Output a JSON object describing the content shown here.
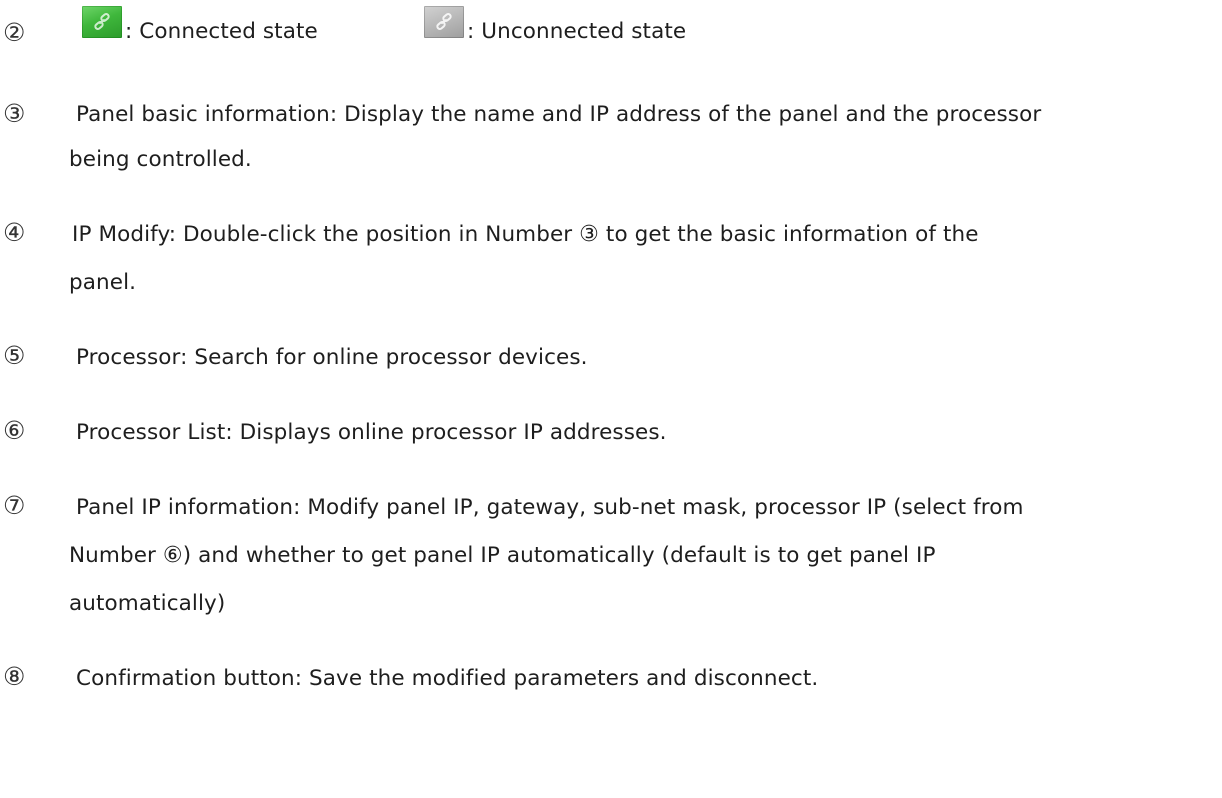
{
  "status_legend": {
    "number": "②",
    "connected_label": ":  Connected state",
    "unconnected_label": ":  Unconnected state",
    "connected_icon": "link-icon",
    "unconnected_icon": "link-icon",
    "connected_color": "#3fb73c",
    "unconnected_color": "#b8b8b8"
  },
  "items": [
    {
      "number": "③",
      "lines": [
        "Panel basic information: Display the name and IP address of the panel and the processor",
        "being controlled."
      ]
    },
    {
      "number": "④",
      "line1_before": "IP Modify: Double-click the position in Number ",
      "line1_ref": "③",
      "line1_after": " to get the basic information of the",
      "line2": "panel."
    },
    {
      "number": "⑤",
      "lines": [
        "Processor: Search for online processor devices."
      ]
    },
    {
      "number": "⑥",
      "lines": [
        "Processor List: Displays online processor IP addresses."
      ]
    },
    {
      "number": "⑦",
      "line1": "Panel IP information: Modify panel IP, gateway, sub-net mask, processor IP (select from",
      "line2_before": "Number ",
      "line2_ref": "⑥",
      "line2_after": ") and whether to get panel IP automatically (default is to get panel IP",
      "line3": "automatically)"
    },
    {
      "number": "⑧",
      "lines": [
        "Confirmation button: Save the modified parameters and disconnect."
      ]
    }
  ]
}
